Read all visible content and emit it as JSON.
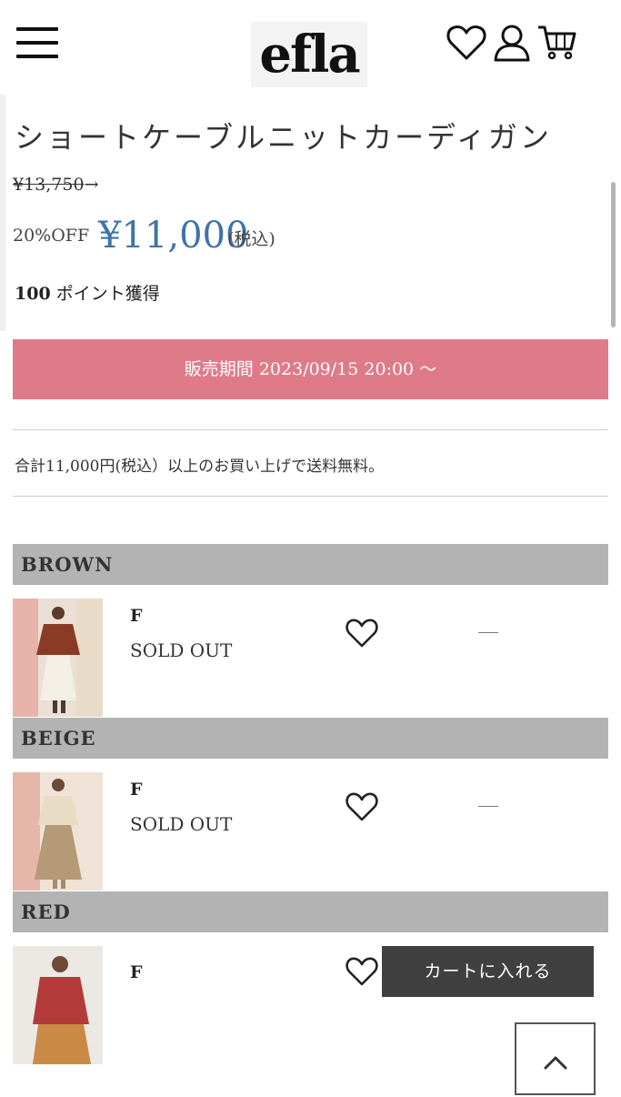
{
  "header": {
    "logo": "efla",
    "icons": [
      "menu-icon",
      "heart-icon",
      "user-icon",
      "cart-icon"
    ]
  },
  "product": {
    "title": "ショートケーブルニットカーディガン",
    "old_price": "¥13,750",
    "old_price_arrow": "→",
    "discount": "20%OFF",
    "price": "¥11,000",
    "tax_note": "(税込)",
    "points_value": "100",
    "points_label": "ポイント獲得",
    "sale_period": "販売期間 2023/09/15 20:00 ～",
    "shipping_note": "合計11,000円(税込）以上のお買い上げで送料無料。"
  },
  "variants": [
    {
      "color": "BROWN",
      "size": "F",
      "status": "SOLD OUT",
      "cart": "—"
    },
    {
      "color": "BEIGE",
      "size": "F",
      "status": "SOLD OUT",
      "cart": "—"
    },
    {
      "color": "RED",
      "size": "F",
      "status": "",
      "cart": "カートに入れる"
    }
  ],
  "colors": {
    "price_blue": "#3f73a8",
    "sale_pink": "#df7b89",
    "color_header_gray": "#b3b3b3",
    "cart_button": "#404040"
  }
}
